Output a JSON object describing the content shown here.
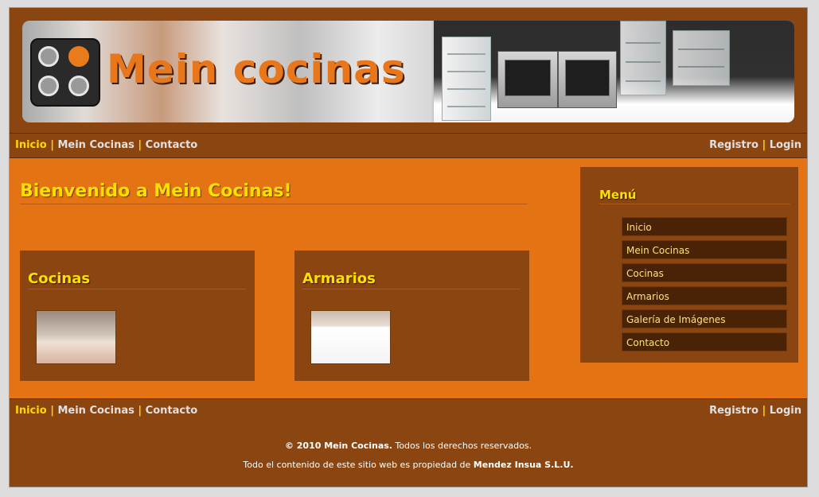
{
  "brand": {
    "name": "Mein cocinas"
  },
  "nav": {
    "left": [
      "Inicio",
      "Mein Cocinas",
      "Contacto"
    ],
    "right": [
      "Registro",
      "Login"
    ],
    "separator": "|"
  },
  "main": {
    "welcome_title": "Bienvenido a Mein Cocinas!",
    "boxes": [
      {
        "title": "Cocinas"
      },
      {
        "title": "Armarios"
      }
    ]
  },
  "sidebar": {
    "title": "Menú",
    "items": [
      "Inicio",
      "Mein Cocinas",
      "Cocinas",
      "Armarios",
      "Galería de Imágenes",
      "Contacto"
    ]
  },
  "footer": {
    "copyright_bold": "© 2010 Mein Cocinas.",
    "copyright_rest": "Todos los derechos reservados.",
    "ownership_text": "Todo el contenido de este sitio web es propiedad de",
    "owner": "Mendez Insua S.L.U."
  },
  "colors": {
    "background": "#e47314",
    "panel": "#8b4510",
    "accent_yellow": "#ffe000",
    "menu_item": "#4a2205"
  }
}
